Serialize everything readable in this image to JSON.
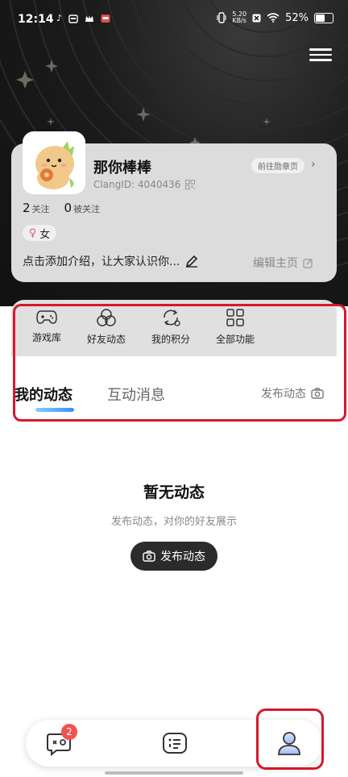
{
  "statusbar": {
    "time": "12:14",
    "speed_value": "5.20",
    "speed_unit": "KB/s",
    "battery": "52%"
  },
  "profile": {
    "username": "那你棒棒",
    "clang_id": "ClangID: 4040436",
    "badge_button": "前往勋章页",
    "following_count": "2",
    "following_label": "关注",
    "followers_count": "0",
    "followers_label": "被关注",
    "gender": "女",
    "intro": "点击添加介绍，让大家认识你...",
    "edit_home": "编辑主页"
  },
  "functions": [
    {
      "label": "游戏库",
      "icon": "gamepad-icon"
    },
    {
      "label": "好友动态",
      "icon": "friends-circles-icon"
    },
    {
      "label": "我的积分",
      "icon": "points-cycle-icon"
    },
    {
      "label": "全部功能",
      "icon": "grid-icon"
    }
  ],
  "tabs": {
    "my_posts": "我的动态",
    "interactions": "互动消息",
    "post_link": "发布动态"
  },
  "empty_state": {
    "title": "暂无动态",
    "subtitle": "发布动态，对你的好友展示",
    "button": "发布动态"
  },
  "bottom_nav": {
    "messages_badge": "2",
    "items": [
      "chat-bubble-icon",
      "list-icon",
      "profile-icon"
    ]
  },
  "colors": {
    "highlight": "#d6182b",
    "tab_underline": "#3d8cff",
    "badge": "#f05252"
  }
}
